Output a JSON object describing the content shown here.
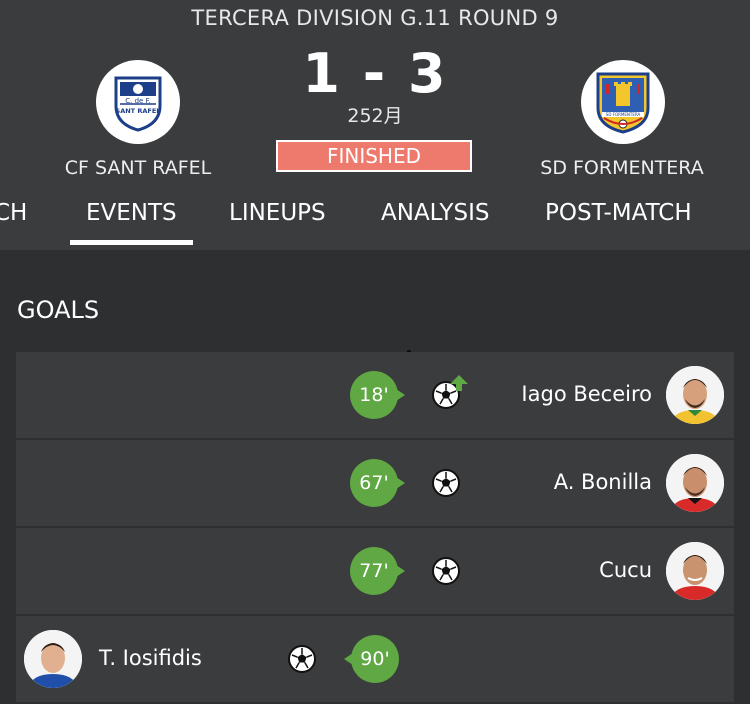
{
  "header": {
    "competition": "TERCERA DIVISION G.11 ROUND 9",
    "score": "1 - 3",
    "attendance": "252月",
    "status": "FINISHED",
    "home_team": {
      "name": "CF SANT RAFEL",
      "crest_text": [
        "C. de F.",
        "SANT RAFEL"
      ]
    },
    "away_team": {
      "name": "SD FORMENTERA",
      "crest_text": "SD FORMENTERA"
    }
  },
  "tabs": [
    {
      "label": "CH"
    },
    {
      "label": "EVENTS",
      "active": true
    },
    {
      "label": "LINEUPS"
    },
    {
      "label": "ANALYSIS"
    },
    {
      "label": "POST-MATCH"
    }
  ],
  "section": {
    "title": "GOALS"
  },
  "goals": [
    {
      "minute": "18'",
      "player": "Iago Beceiro",
      "side": "away",
      "icon": "soccer-ball-icon",
      "extra_icon": "substitution-up-arrow-icon",
      "kit": "#f2c230"
    },
    {
      "minute": "67'",
      "player": "A. Bonilla",
      "side": "away",
      "icon": "soccer-ball-icon",
      "kit": "#d92a2a"
    },
    {
      "minute": "77'",
      "player": "Cucu",
      "side": "away",
      "icon": "soccer-ball-icon",
      "kit": "#d92a2a"
    },
    {
      "minute": "90'",
      "player": "T. Iosifidis",
      "side": "home",
      "icon": "soccer-ball-icon",
      "kit": "#1f4fa8"
    }
  ],
  "colors": {
    "background": "#2d2f31",
    "panel": "#3a3c3e",
    "status": "#ee7a6d",
    "minute_badge": "#5fa843"
  }
}
